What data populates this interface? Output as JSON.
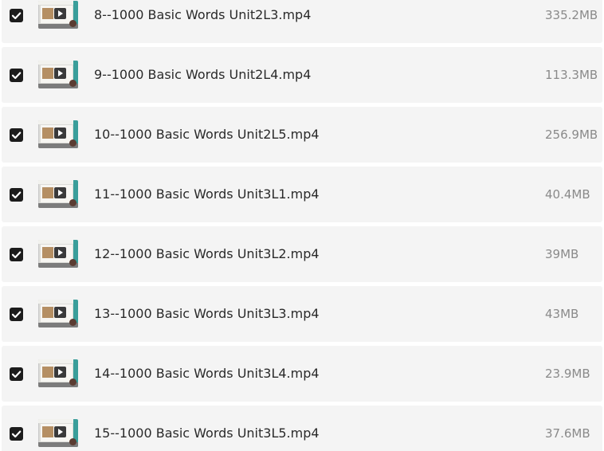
{
  "files": [
    {
      "name": "8--1000 Basic Words Unit2L3.mp4",
      "size": "335.2MB",
      "checked": true
    },
    {
      "name": "9--1000 Basic Words Unit2L4.mp4",
      "size": "113.3MB",
      "checked": true
    },
    {
      "name": "10--1000 Basic Words Unit2L5.mp4",
      "size": "256.9MB",
      "checked": true
    },
    {
      "name": "11--1000 Basic Words Unit3L1.mp4",
      "size": "40.4MB",
      "checked": true
    },
    {
      "name": "12--1000 Basic Words Unit3L2.mp4",
      "size": "39MB",
      "checked": true
    },
    {
      "name": "13--1000 Basic Words Unit3L3.mp4",
      "size": "43MB",
      "checked": true
    },
    {
      "name": "14--1000 Basic Words Unit3L4.mp4",
      "size": "23.9MB",
      "checked": true
    },
    {
      "name": "15--1000 Basic Words Unit3L5.mp4",
      "size": "37.6MB",
      "checked": true
    }
  ],
  "icons": {
    "checkbox": "checkmark-icon",
    "thumbnail": "video-thumbnail-icon"
  },
  "colors": {
    "row_background": "#f4f4f4",
    "checkbox": "#1c1c1c",
    "name_text": "#2a2a2a",
    "size_text": "#8a8a8a",
    "thumbnail_accent": "#3a9e9a"
  }
}
